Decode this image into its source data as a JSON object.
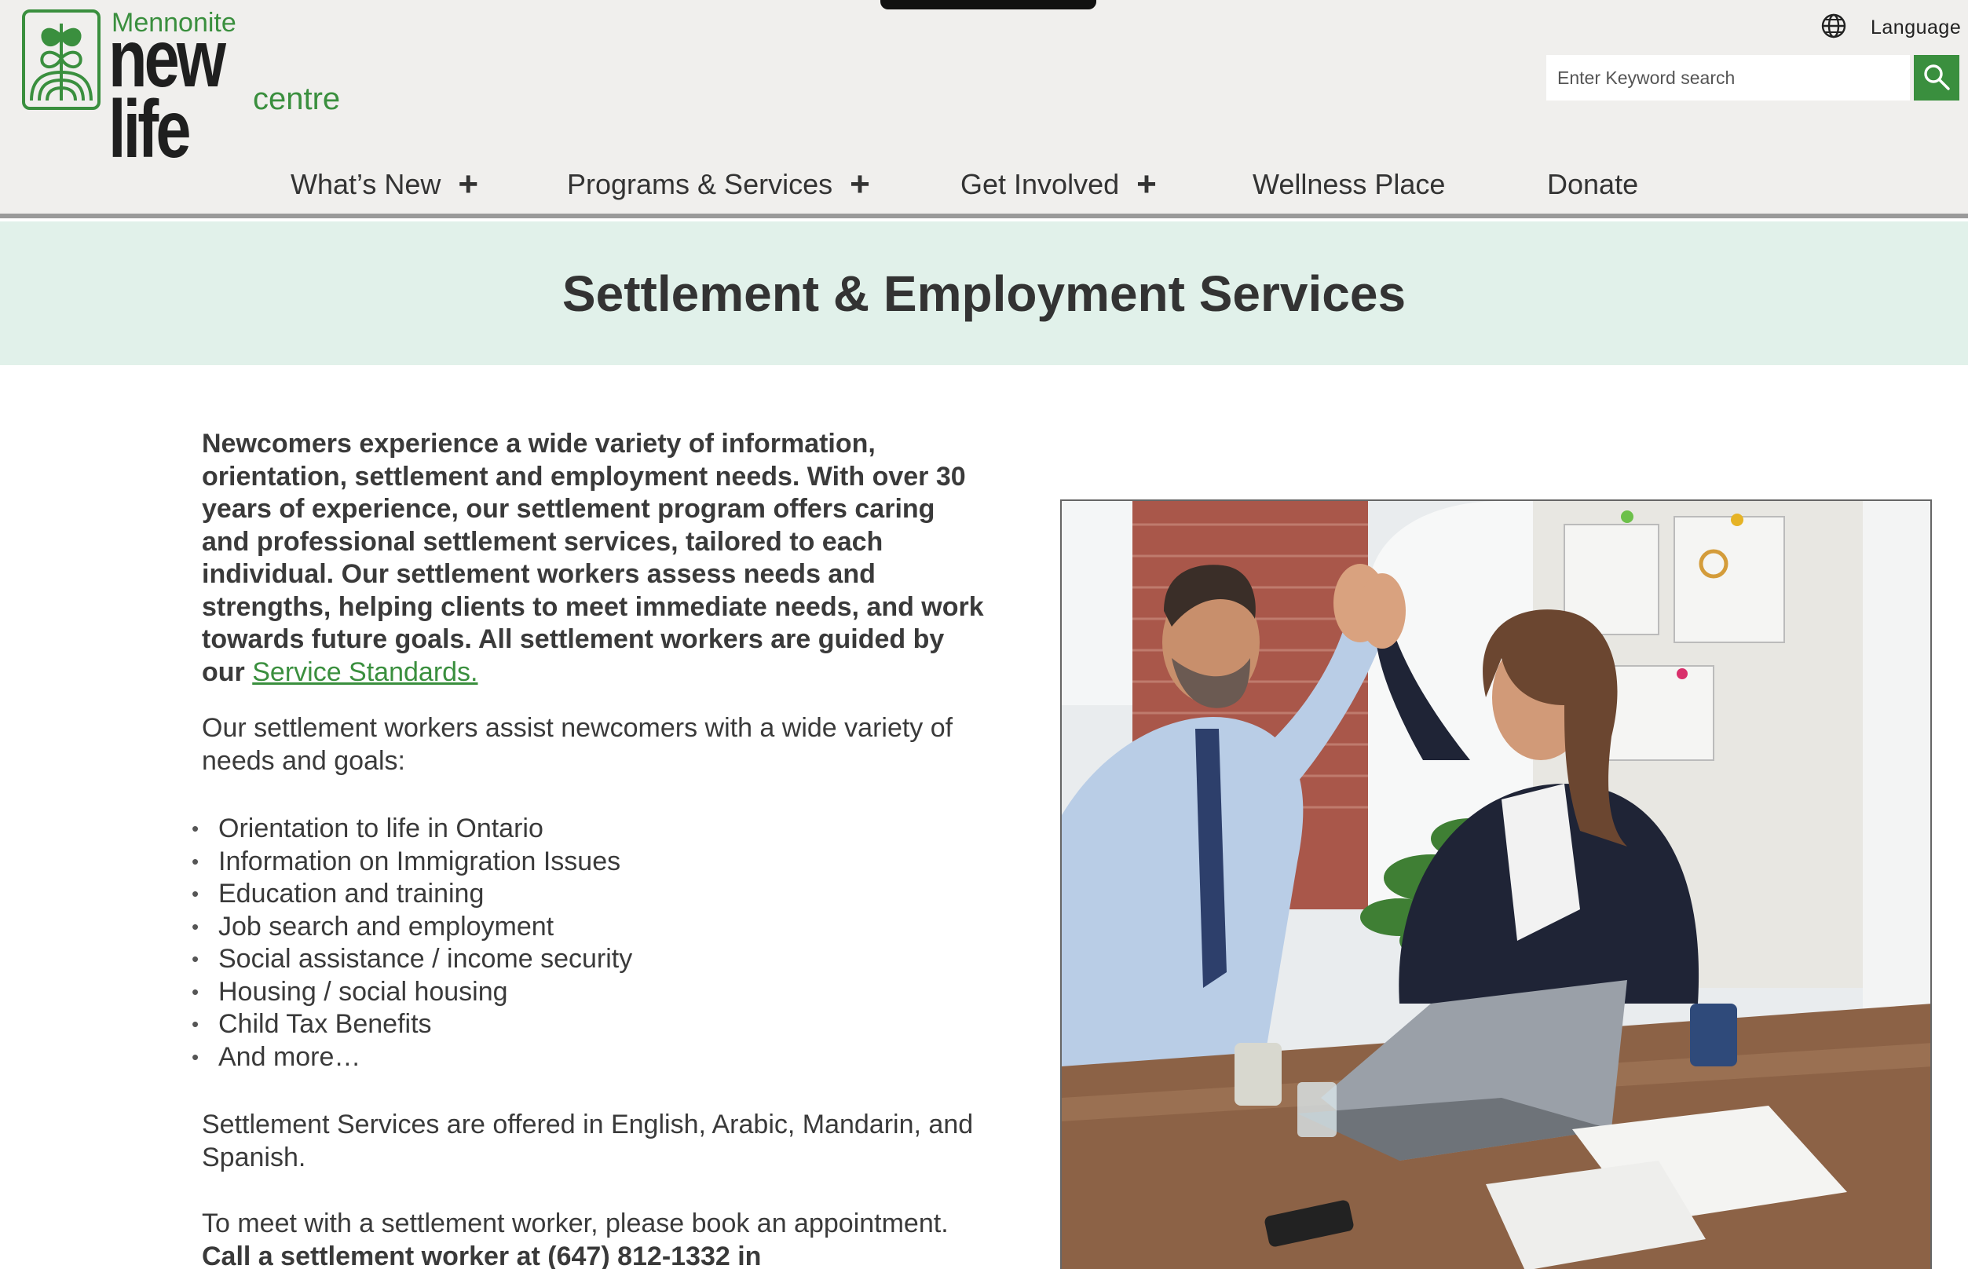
{
  "header": {
    "logo": {
      "line1": "Mennonite",
      "line2": "new life",
      "line3": "centre"
    },
    "language_label": "Language",
    "search": {
      "placeholder": "Enter Keyword search"
    },
    "icons": {
      "globe": "globe-icon",
      "search": "search-icon"
    },
    "accent_color": "#3a8f3e"
  },
  "nav": {
    "items": [
      {
        "label": "What’s New",
        "expandable": true
      },
      {
        "label": "Programs & Services",
        "expandable": true
      },
      {
        "label": "Get Involved",
        "expandable": true
      },
      {
        "label": "Wellness Place",
        "expandable": false
      },
      {
        "label": "Donate",
        "expandable": false
      }
    ]
  },
  "page": {
    "title": "Settlement & Employment Services",
    "intro": "Newcomers experience a wide variety of information, orientation, settlement and employment needs. With over 30 years of experience, our settlement program offers caring and professional settlement services, tailored to each individual. Our settlement workers assess needs and strengths, helping clients to meet immediate needs, and work towards future goals. All settlement workers are guided by our",
    "intro_link": "Service Standards.",
    "assist_text": "Our settlement workers assist newcomers with a wide variety of needs and goals:",
    "needs": [
      "Orientation to life in Ontario",
      "Information on Immigration Issues",
      "Education and training",
      "Job search and employment",
      "Social assistance / income security",
      "Housing / social housing",
      "Child Tax Benefits",
      "And more…"
    ],
    "languages_text": "Settlement Services are offered in English, Arabic, Mandarin, and Spanish.",
    "booking_text": "To meet with a settlement worker, please book an appointment.",
    "booking_bold": "Call a settlement worker at (647) 812-1332 in"
  }
}
